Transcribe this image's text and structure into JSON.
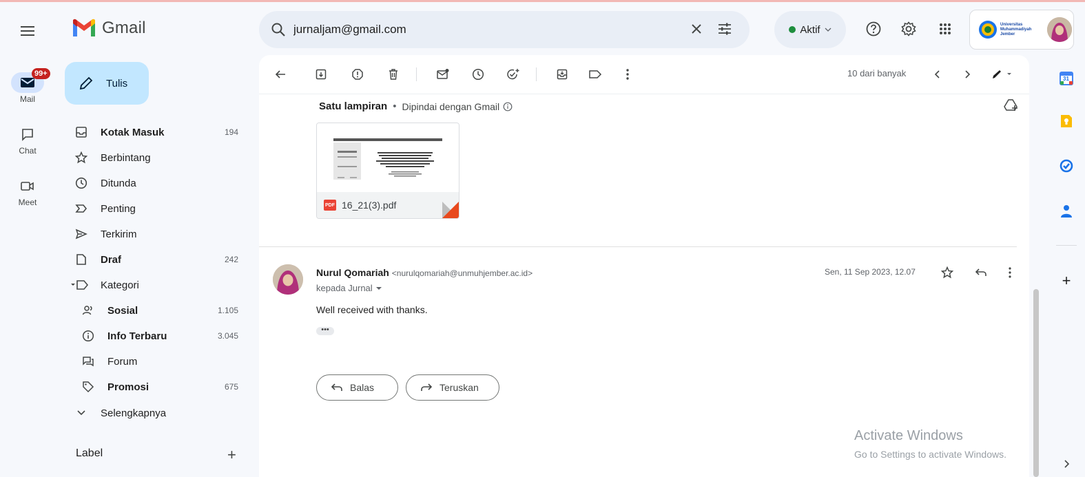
{
  "app": {
    "name": "Gmail"
  },
  "rail": {
    "mail_label": "Mail",
    "mail_badge": "99+",
    "chat_label": "Chat",
    "meet_label": "Meet"
  },
  "search": {
    "value": "jurnaljam@gmail.com"
  },
  "header": {
    "status": "Aktif",
    "account_org_lines": [
      "Universitas",
      "Muhammadiyah",
      "Jember"
    ]
  },
  "compose": {
    "label": "Tulis"
  },
  "folders": [
    {
      "label": "Kotak Masuk",
      "count": "194",
      "icon": "inbox-icon",
      "bold": true
    },
    {
      "label": "Berbintang",
      "count": "",
      "icon": "star-icon",
      "bold": false
    },
    {
      "label": "Ditunda",
      "count": "",
      "icon": "clock-icon",
      "bold": false
    },
    {
      "label": "Penting",
      "count": "",
      "icon": "important-icon",
      "bold": false
    },
    {
      "label": "Terkirim",
      "count": "",
      "icon": "send-icon",
      "bold": false
    },
    {
      "label": "Draf",
      "count": "242",
      "icon": "draft-icon",
      "bold": true
    },
    {
      "label": "Kategori",
      "count": "",
      "icon": "label-icon",
      "bold": false
    }
  ],
  "categories": [
    {
      "label": "Sosial",
      "count": "1.105",
      "icon": "people-icon"
    },
    {
      "label": "Info Terbaru",
      "count": "3.045",
      "icon": "info-icon"
    },
    {
      "label": "Forum",
      "count": "",
      "icon": "forum-icon"
    },
    {
      "label": "Promosi",
      "count": "675",
      "icon": "tag-icon"
    }
  ],
  "more": {
    "label": "Selengkapnya"
  },
  "labels": {
    "header": "Label",
    "add": "+"
  },
  "toolbar": {
    "pager": "10 dari banyak"
  },
  "attachment": {
    "title": "Satu lampiran",
    "scanned": "Dipindai dengan Gmail",
    "file_name": "16_21(3).pdf",
    "file_type": "PDF"
  },
  "message": {
    "sender_name": "Nurul Qomariah",
    "sender_email": "<nurulqomariah@unmuhjember.ac.id>",
    "to": "kepada Jurnal",
    "date": "Sen, 11 Sep 2023, 12.07",
    "body": "Well received with thanks.",
    "ellipsis": "•••"
  },
  "actions": {
    "reply": "Balas",
    "forward": "Teruskan"
  },
  "side_panel": {
    "add": "+",
    "calendar_day": "31"
  },
  "watermark": {
    "line1": "Activate Windows",
    "line2": "Go to Settings to activate Windows."
  },
  "colors": {
    "accent": "#0b57d0",
    "compose_bg": "#c2e7ff",
    "page_bg": "#f6f8fc",
    "status_green": "#1e8e3e",
    "badge_red": "#c5221f"
  }
}
